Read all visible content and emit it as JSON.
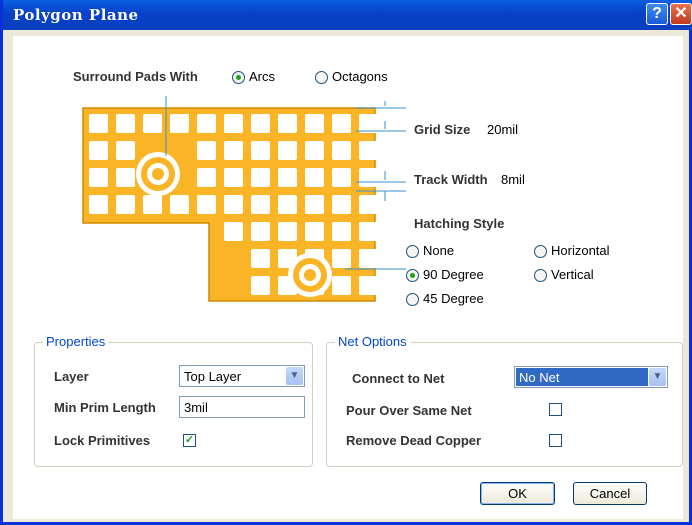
{
  "window": {
    "title": "Polygon Plane",
    "help": "?",
    "close": "✕"
  },
  "surround": {
    "label": "Surround Pads With",
    "options": [
      "Arcs",
      "Octagons"
    ],
    "selected": "Arcs"
  },
  "grid_size": {
    "label": "Grid Size",
    "value": "20mil"
  },
  "track_width": {
    "label": "Track Width",
    "value": "8mil"
  },
  "hatching": {
    "label": "Hatching Style",
    "options": [
      "None",
      "90 Degree",
      "45 Degree",
      "Horizontal",
      "Vertical"
    ],
    "selected": "90 Degree"
  },
  "properties": {
    "title": "Properties",
    "layer_label": "Layer",
    "layer_value": "Top Layer",
    "min_prim_label": "Min Prim Length",
    "min_prim_value": "3mil",
    "lock_label": "Lock Primitives",
    "lock_checked": true
  },
  "net_options": {
    "title": "Net Options",
    "connect_label": "Connect to Net",
    "connect_value": "No Net",
    "pour_label": "Pour Over Same Net",
    "pour_checked": false,
    "remove_label": "Remove Dead Copper",
    "remove_checked": false
  },
  "buttons": {
    "ok": "OK",
    "cancel": "Cancel"
  },
  "colors": {
    "copper": "#f9b526",
    "title_bar": "#0a5fe0",
    "accent": "#0046d5",
    "check": "#21a121"
  }
}
